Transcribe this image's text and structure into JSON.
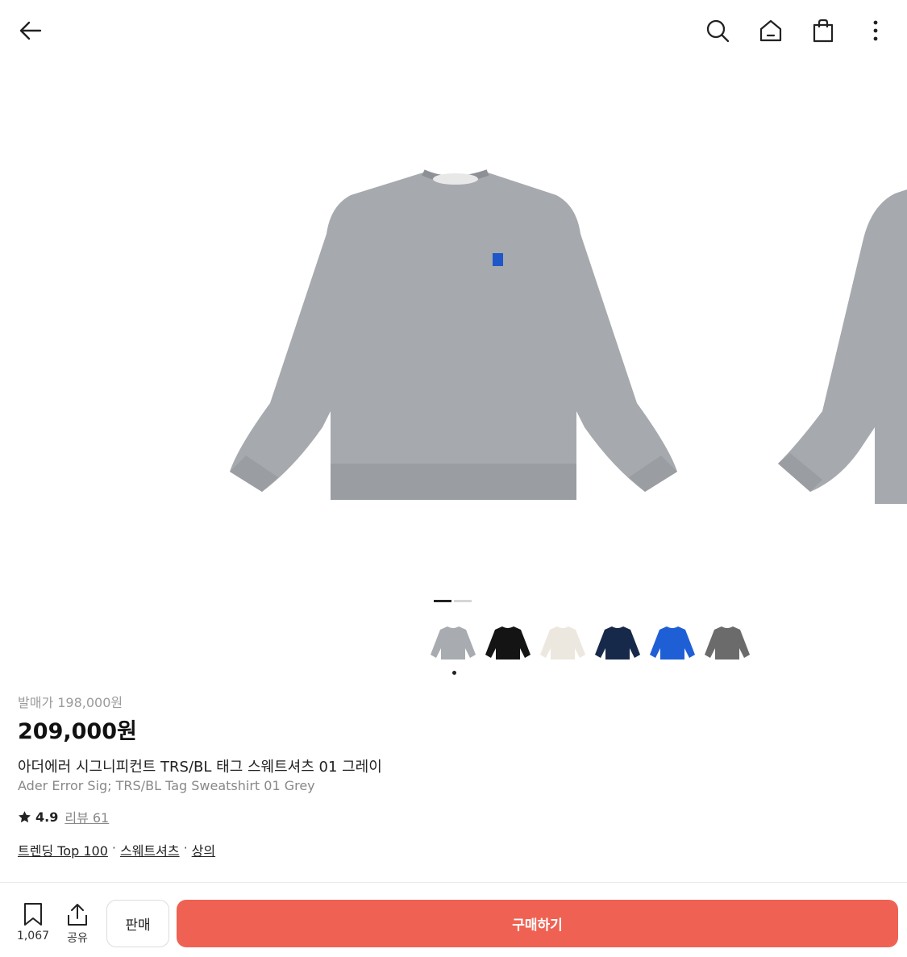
{
  "header": {
    "back_icon": "arrow-left-icon",
    "search_icon": "search-icon",
    "home_icon": "home-icon",
    "cart_icon": "shopping-bag-icon",
    "more_icon": "more-vertical-icon"
  },
  "gallery": {
    "active_slide": 1,
    "total_slides": 2,
    "product_color": "#a6a9ad",
    "logo_color": "#1f56c8"
  },
  "color_options": [
    {
      "color": "#a8abaf",
      "selected": true
    },
    {
      "color": "#141414",
      "selected": false
    },
    {
      "color": "#ece8df",
      "selected": false
    },
    {
      "color": "#17294a",
      "selected": false
    },
    {
      "color": "#1f5fd6",
      "selected": false
    },
    {
      "color": "#6b6b6b",
      "selected": false
    }
  ],
  "product": {
    "release_price": "발매가 198,000원",
    "price": "209,000원",
    "name_ko": "아더에러 시그니피컨트 TRS/BL 태그 스웨트셔츠 01 그레이",
    "name_en": "Ader Error Sig; TRS/BL Tag Sweatshirt 01 Grey",
    "rating": "4.9",
    "review_label": "리뷰 61",
    "tags": [
      "트렌딩 Top 100",
      "스웨트셔츠",
      "상의"
    ],
    "tag_separator": "·"
  },
  "bottom_bar": {
    "bookmark_count": "1,067",
    "share_label": "공유",
    "sell_label": "판매",
    "buy_label": "구매하기",
    "buy_color": "#ef6253"
  }
}
